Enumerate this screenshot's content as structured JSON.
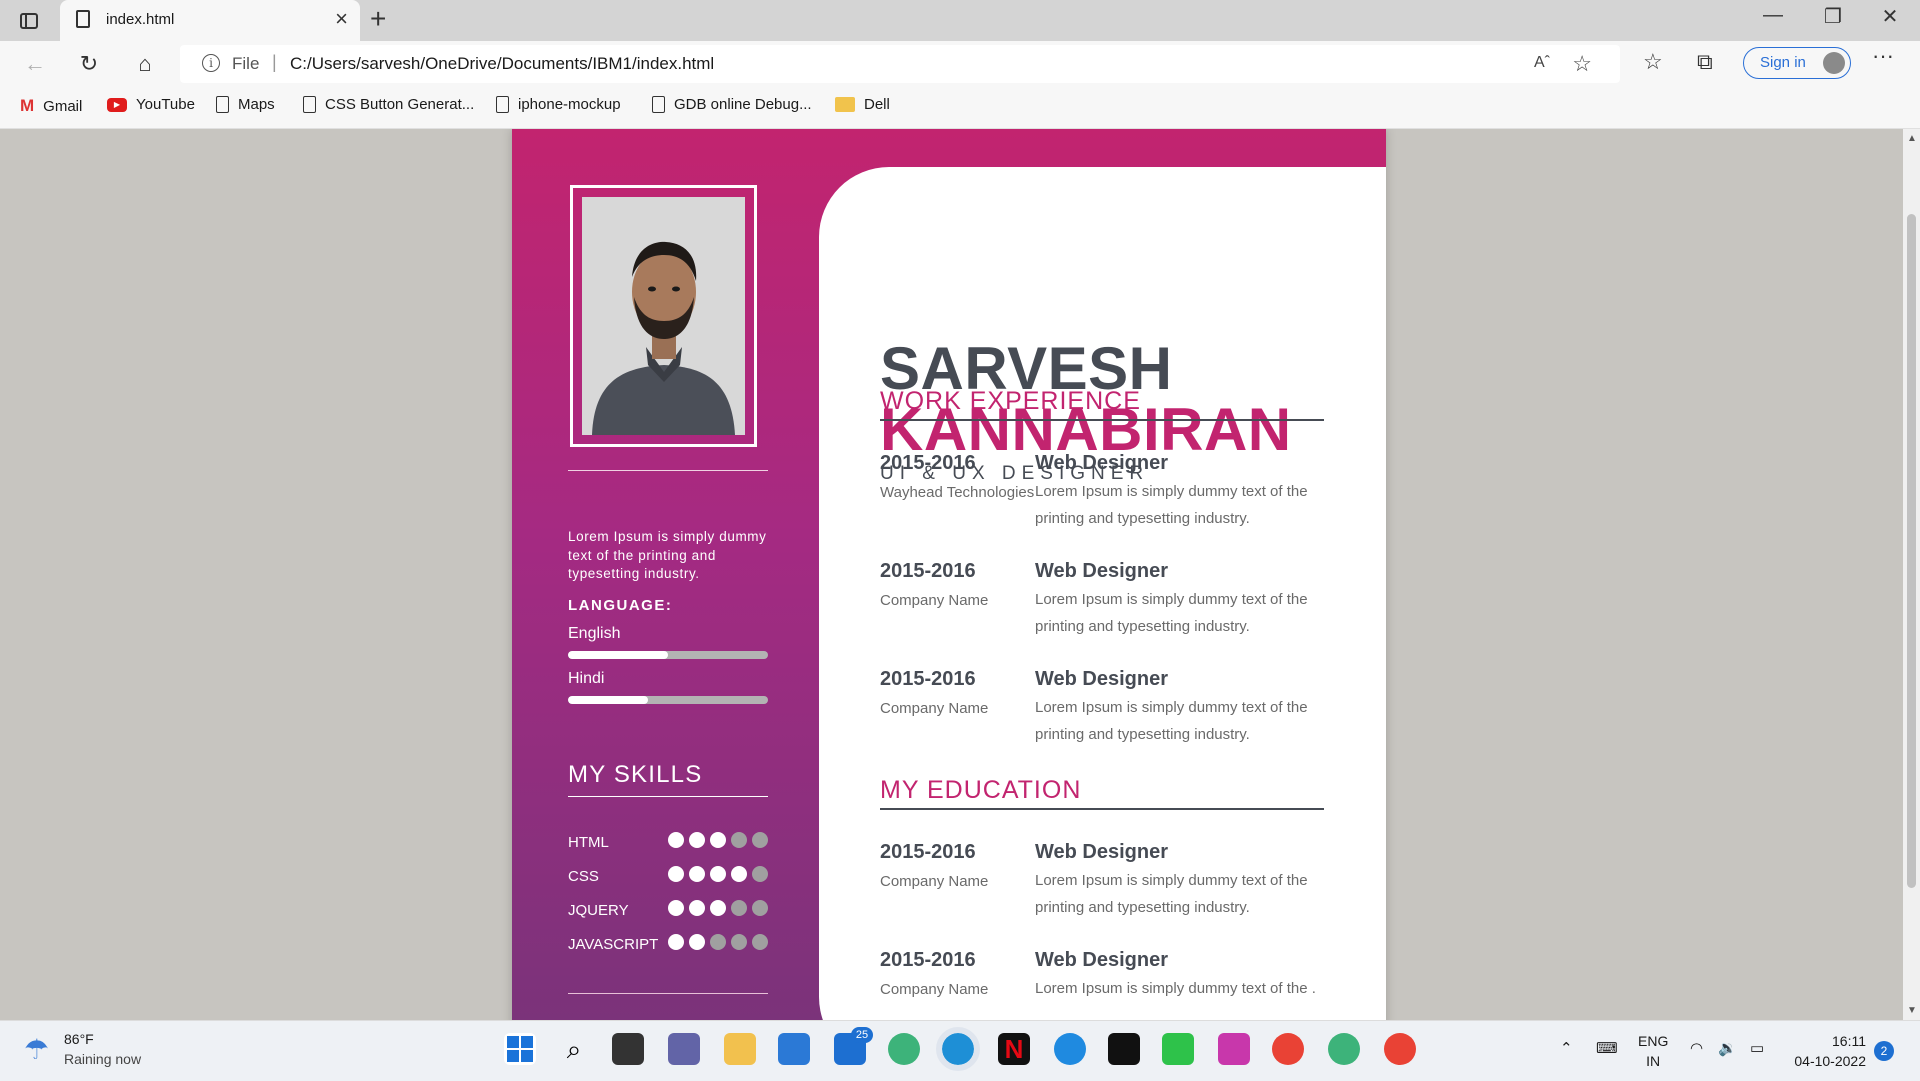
{
  "browser": {
    "tab_title": "index.html",
    "scheme_label": "File",
    "url": "C:/Users/sarvesh/OneDrive/Documents/IBM1/index.html",
    "signin_label": "Sign in",
    "read_aloud_label": "Aˆ"
  },
  "bookmarks": [
    {
      "label": "Gmail",
      "icon": "gmail-icon"
    },
    {
      "label": "YouTube",
      "icon": "youtube-icon"
    },
    {
      "label": "Maps",
      "icon": "page-icon"
    },
    {
      "label": "CSS Button Generat...",
      "icon": "page-icon"
    },
    {
      "label": "iphone-mockup",
      "icon": "page-icon"
    },
    {
      "label": "GDB online Debug...",
      "icon": "page-icon"
    },
    {
      "label": "Dell",
      "icon": "folder-icon"
    }
  ],
  "resume": {
    "first_name": "SARVESH",
    "last_name": "KANNABIRAN",
    "role": "UI & UX DESIGNER",
    "about": "Lorem Ipsum is simply dummy text of the printing and typesetting industry.",
    "language_heading": "LANGUAGE:",
    "languages": [
      {
        "name": "English",
        "level": 0.5
      },
      {
        "name": "Hindi",
        "level": 0.4
      }
    ],
    "skills_heading": "MY SKILLS",
    "skills": [
      {
        "name": "HTML",
        "rating": 3,
        "max": 5
      },
      {
        "name": "CSS",
        "rating": 4,
        "max": 5
      },
      {
        "name": "JQUERY",
        "rating": 3,
        "max": 5
      },
      {
        "name": "JAVASCRIPT",
        "rating": 2,
        "max": 5
      }
    ],
    "work_heading": "WORK EXPERIENCE",
    "work": [
      {
        "years": "2015-2016",
        "company": "Wayhead Technologies",
        "title": "Web Designer",
        "desc": "Lorem Ipsum is simply dummy text of the printing and typesetting industry."
      },
      {
        "years": "2015-2016",
        "company": "Company Name",
        "title": "Web Designer",
        "desc": "Lorem Ipsum is simply dummy text of the printing and typesetting industry."
      },
      {
        "years": "2015-2016",
        "company": "Company Name",
        "title": "Web Designer",
        "desc": "Lorem Ipsum is simply dummy text of the printing and typesetting industry."
      }
    ],
    "education_heading": "MY EDUCATION",
    "education": [
      {
        "years": "2015-2016",
        "company": "Company Name",
        "title": "Web Designer",
        "desc": "Lorem Ipsum is simply dummy text of the printing and typesetting industry."
      },
      {
        "years": "2015-2016",
        "company": "Company Name",
        "title": "Web Designer",
        "desc": "Lorem Ipsum is simply dummy text of the ."
      }
    ],
    "colors": {
      "accent": "#c2246f",
      "dark_text": "#464b54",
      "sidebar_top": "#c2246f",
      "sidebar_bottom": "#7a337a"
    }
  },
  "taskbar": {
    "temperature": "86°F",
    "condition": "Raining now",
    "mail_badge": "25",
    "lang_line1": "ENG",
    "lang_line2": "IN",
    "time": "16:11",
    "date": "04-10-2022",
    "notifications": "2"
  }
}
